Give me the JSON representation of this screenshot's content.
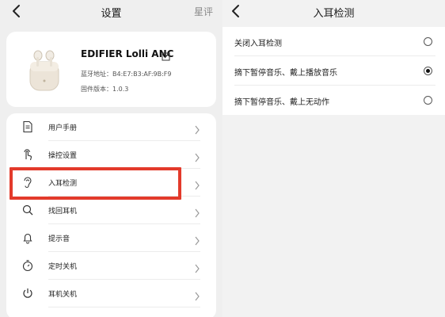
{
  "left_screen": {
    "title": "设置",
    "rate_label": "星评",
    "device": {
      "name": "EDIFIER Lolli ANC",
      "bluetooth_label": "蓝牙地址：",
      "bluetooth_address": "B4:E7:B3:AF:9B:F9",
      "firmware_label": "固件版本：",
      "firmware_version": "1.0.3"
    },
    "menu": [
      {
        "label": "用户手册",
        "icon": "manual-icon"
      },
      {
        "label": "操控设置",
        "icon": "touch-icon"
      },
      {
        "label": "入耳检测",
        "icon": "ear-icon"
      },
      {
        "label": "找回耳机",
        "icon": "search-icon"
      },
      {
        "label": "提示音",
        "icon": "bell-icon"
      },
      {
        "label": "定时关机",
        "icon": "timer-icon"
      },
      {
        "label": "耳机关机",
        "icon": "power-icon"
      }
    ],
    "highlight_color": "#e33a2b"
  },
  "right_screen": {
    "title": "入耳检测",
    "options": [
      {
        "label": "关闭入耳检测",
        "selected": false
      },
      {
        "label": "摘下暂停音乐、戴上播放音乐",
        "selected": true
      },
      {
        "label": "摘下暂停音乐、戴上无动作",
        "selected": false
      }
    ]
  }
}
